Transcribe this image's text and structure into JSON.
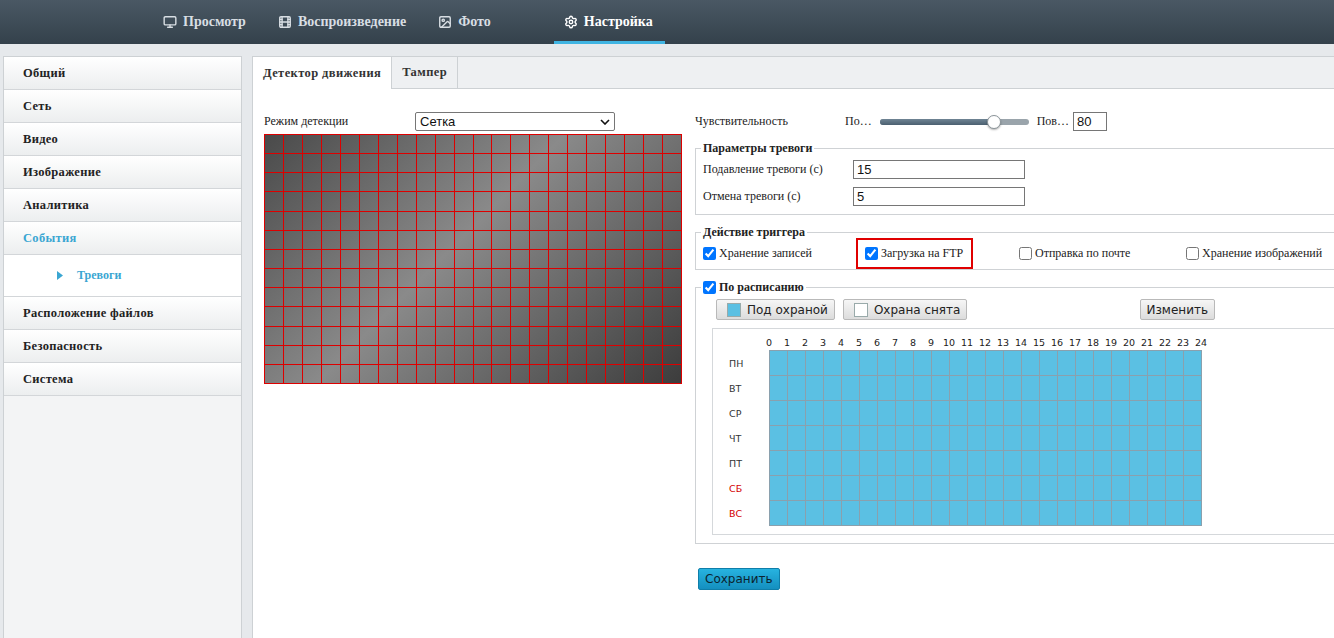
{
  "nav": [
    {
      "label": "Просмотр",
      "selected": false
    },
    {
      "label": "Воспроизведение",
      "selected": false
    },
    {
      "label": "Фото",
      "selected": false
    },
    {
      "label": "Настройка",
      "selected": true
    }
  ],
  "sidebar": {
    "items": [
      {
        "label": "Общий",
        "selected": false,
        "expanded": false,
        "children": []
      },
      {
        "label": "Сеть",
        "selected": false,
        "expanded": false,
        "children": []
      },
      {
        "label": "Видео",
        "selected": false,
        "expanded": false,
        "children": []
      },
      {
        "label": "Изображение",
        "selected": false,
        "expanded": false,
        "children": []
      },
      {
        "label": "Аналитика",
        "selected": false,
        "expanded": false,
        "children": []
      },
      {
        "label": "События",
        "selected": true,
        "expanded": true,
        "children": [
          {
            "label": "Тревоги",
            "selected": true
          }
        ]
      },
      {
        "label": "Расположение файлов",
        "selected": false,
        "expanded": false,
        "children": []
      },
      {
        "label": "Безопасность",
        "selected": false,
        "expanded": false,
        "children": []
      },
      {
        "label": "Система",
        "selected": false,
        "expanded": false,
        "children": []
      }
    ]
  },
  "tabs": [
    {
      "label": "Детектор движения",
      "selected": true
    },
    {
      "label": "Тампер",
      "selected": false
    }
  ],
  "detection": {
    "mode_label": "Режим детекции",
    "mode_value": "Сетка",
    "grid": {
      "columns": 22,
      "rows": 13,
      "selected": true
    }
  },
  "sensitivity": {
    "label": "Чувствительность",
    "min_label": "По…",
    "max_label": "Пов…",
    "level": 0.77,
    "value": "80"
  },
  "alarm_params": {
    "title": "Параметры тревоги",
    "fields": [
      {
        "label": "Подавление тревоги (с)",
        "value": "15"
      },
      {
        "label": "Отмена тревоги (с)",
        "value": "5"
      }
    ]
  },
  "trigger": {
    "title": "Действие триггера",
    "options": [
      {
        "label": "Хранение записей",
        "checked": true,
        "highlighted": false
      },
      {
        "label": "Загрузка на FTP",
        "checked": true,
        "highlighted": true
      },
      {
        "label": "Отправка по почте",
        "checked": false,
        "highlighted": false
      },
      {
        "label": "Хранение изображений",
        "checked": false,
        "highlighted": false
      }
    ]
  },
  "schedule": {
    "title": "По расписанию",
    "checked": true,
    "legend": [
      {
        "label": "Под охраной",
        "color": "#5bc0e3"
      },
      {
        "label": "Охрана снята",
        "color": "#ffffff"
      }
    ],
    "edit_button": "Изменить",
    "hours": [
      "0",
      "1",
      "2",
      "3",
      "4",
      "5",
      "6",
      "7",
      "8",
      "9",
      "10",
      "11",
      "12",
      "13",
      "14",
      "15",
      "16",
      "17",
      "18",
      "19",
      "20",
      "21",
      "22",
      "23",
      "24"
    ],
    "days": [
      {
        "label": "ПН",
        "weekend": false,
        "armed": [
          [
            0,
            24
          ]
        ]
      },
      {
        "label": "ВТ",
        "weekend": false,
        "armed": [
          [
            0,
            24
          ]
        ]
      },
      {
        "label": "СР",
        "weekend": false,
        "armed": [
          [
            0,
            24
          ]
        ]
      },
      {
        "label": "ЧТ",
        "weekend": false,
        "armed": [
          [
            0,
            24
          ]
        ]
      },
      {
        "label": "ПТ",
        "weekend": false,
        "armed": [
          [
            0,
            24
          ]
        ]
      },
      {
        "label": "СБ",
        "weekend": true,
        "armed": [
          [
            0,
            24
          ]
        ]
      },
      {
        "label": "ВС",
        "weekend": true,
        "armed": [
          [
            0,
            24
          ]
        ]
      }
    ]
  },
  "save_button": "Сохранить"
}
